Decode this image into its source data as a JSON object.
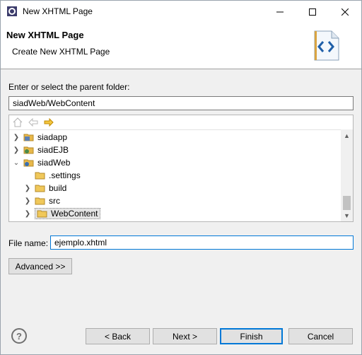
{
  "window": {
    "title": "New XHTML Page"
  },
  "banner": {
    "title": "New XHTML Page",
    "description": "Create New XHTML Page"
  },
  "folder": {
    "label": "Enter or select the parent folder:",
    "value": "siadWeb/WebContent"
  },
  "tree": {
    "items": [
      {
        "label": "siadapp",
        "expanded": false,
        "icon": "project-icon"
      },
      {
        "label": "siadEJB",
        "expanded": false,
        "icon": "ejb-project-icon"
      },
      {
        "label": "siadWeb",
        "expanded": true,
        "icon": "web-project-icon"
      },
      {
        "label": ".settings",
        "icon": "folder-icon"
      },
      {
        "label": "build",
        "expanded": false,
        "icon": "folder-icon"
      },
      {
        "label": "src",
        "expanded": false,
        "icon": "folder-icon"
      },
      {
        "label": "WebContent",
        "expanded": false,
        "icon": "folder-icon",
        "selected": true
      }
    ]
  },
  "file": {
    "label": "File name:",
    "value": "ejemplo.xhtml"
  },
  "buttons": {
    "advanced": "Advanced >>",
    "back": "< Back",
    "next": "Next >",
    "finish": "Finish",
    "cancel": "Cancel",
    "help": "?"
  },
  "colors": {
    "accent": "#0078d7",
    "folder": "#e8b84a",
    "forward_arrow": "#e0a800"
  }
}
